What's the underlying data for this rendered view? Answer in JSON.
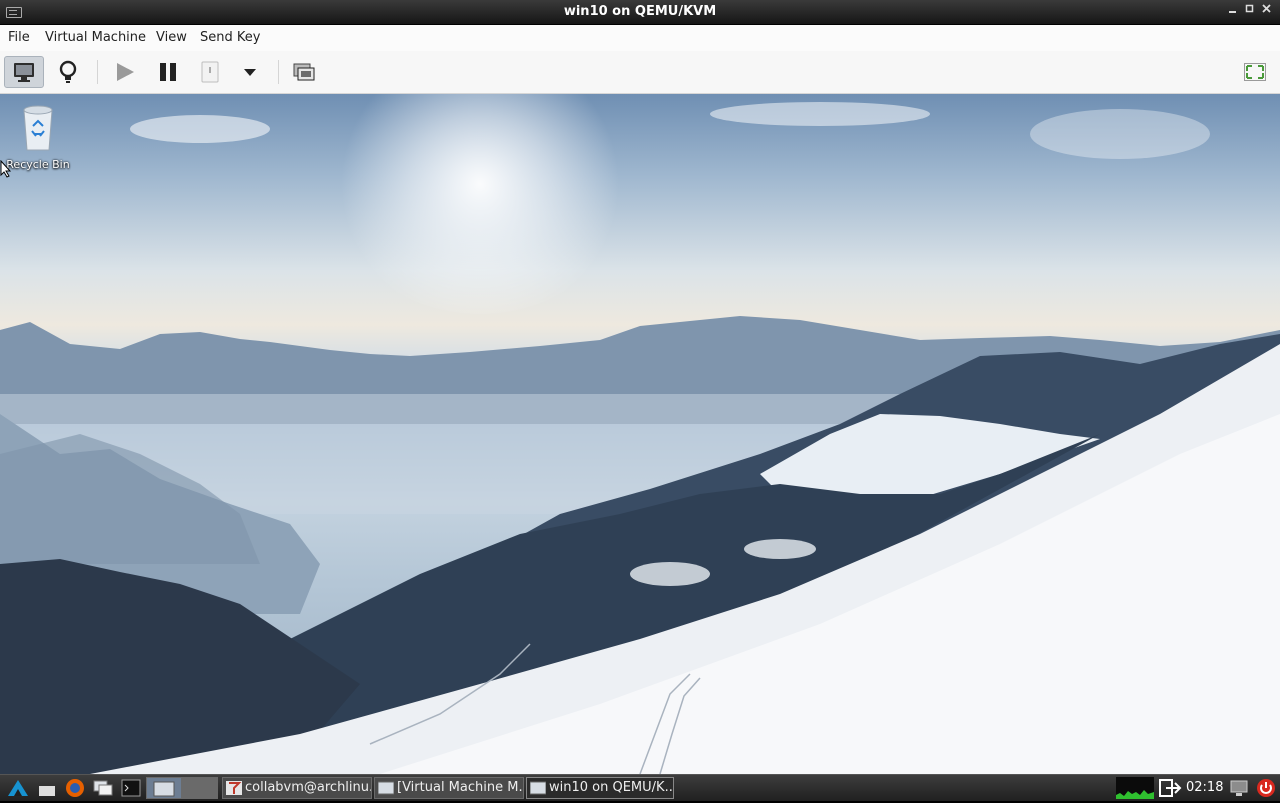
{
  "window": {
    "title": "win10 on QEMU/KVM",
    "controls": [
      "minimize-icon",
      "maximize-icon",
      "close-icon"
    ]
  },
  "menubar": {
    "file": "File",
    "virtual_machine": "Virtual Machine",
    "view": "View",
    "send_key": "Send Key"
  },
  "toolbar": {
    "buttons": [
      "console-icon",
      "details-lightbulb-icon",
      "run-icon",
      "pause-icon",
      "shutdown-icon",
      "dropdown-icon",
      "snapshots-icon",
      "fullscreen-icon"
    ],
    "active": "console-icon"
  },
  "desktop": {
    "recycle_bin_label": "Recycle Bin"
  },
  "taskbar": {
    "launchers": [
      "start-icon",
      "firefox-icon",
      "files-icon",
      "terminal-icon",
      "virt-manager-icon"
    ],
    "tasks": [
      {
        "label": "collabvm@archlinu...",
        "icon": "text-editor-icon"
      },
      {
        "label": "[Virtual Machine M...",
        "icon": "vm-icon"
      },
      {
        "label": "win10 on QEMU/K...",
        "icon": "vm-icon",
        "active": true
      }
    ],
    "clock": "02:18",
    "tray": [
      "cpu-graph",
      "logout-icon",
      "display-icon",
      "power-icon"
    ]
  },
  "colors": {
    "accent": "#2a7fd4",
    "power": "#d9291f"
  }
}
